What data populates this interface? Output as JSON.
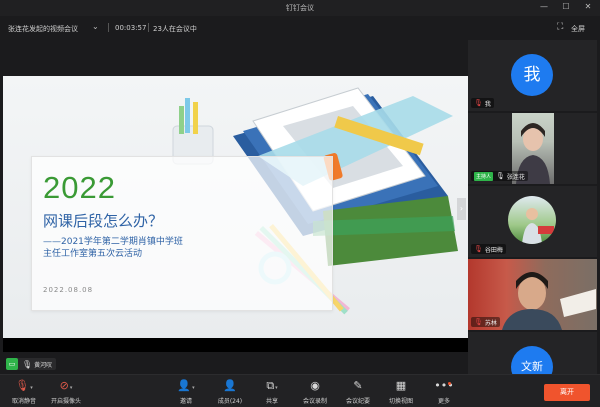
{
  "window": {
    "title": "钉钉会议",
    "minimize": "—",
    "maximize": "☐",
    "close": "✕"
  },
  "infobar": {
    "meeting_name": "张连花发起的视频会议",
    "timer": "00:03:57",
    "participants": "23人在会议中",
    "fullscreen_label": "全屏"
  },
  "slide": {
    "year": "2022",
    "headline": "网课后段怎么办？",
    "subtitle_line1": "——2021学年第二学期肖镇中学班",
    "subtitle_line2": "主任工作室第五次云活动",
    "date": "2022.08.08",
    "next_arrow": "›"
  },
  "presenter": {
    "name": "黄河叹"
  },
  "participants": [
    {
      "name": "我",
      "avatar_text": "我",
      "avatar_color": "#1e7bf0"
    },
    {
      "name": "张连花",
      "role": "主持人"
    },
    {
      "name": "谷田梅"
    },
    {
      "name": "苏林"
    },
    {
      "name": "",
      "avatar_text": "文新",
      "avatar_color": "#1e7bf0"
    }
  ],
  "toolbar": {
    "items": [
      {
        "label": "取消静音",
        "icon": "mic-icon"
      },
      {
        "label": "开启摄像头",
        "icon": "camera-icon"
      },
      {
        "label": "邀请",
        "icon": "invite-icon"
      },
      {
        "label": "成员(24)",
        "icon": "members-icon"
      },
      {
        "label": "共享",
        "icon": "share-icon"
      },
      {
        "label": "会议录制",
        "icon": "record-icon"
      },
      {
        "label": "会议纪要",
        "icon": "notes-icon"
      },
      {
        "label": "切换视图",
        "icon": "view-icon"
      },
      {
        "label": "更多",
        "icon": "more-icon"
      }
    ],
    "leave_label": "离开"
  },
  "colors": {
    "leave": "#f0542d",
    "accent_blue": "#1e7bf0",
    "host_green": "#2fb44a",
    "slide_green": "#3a9a35",
    "slide_blue": "#2f63a6"
  }
}
